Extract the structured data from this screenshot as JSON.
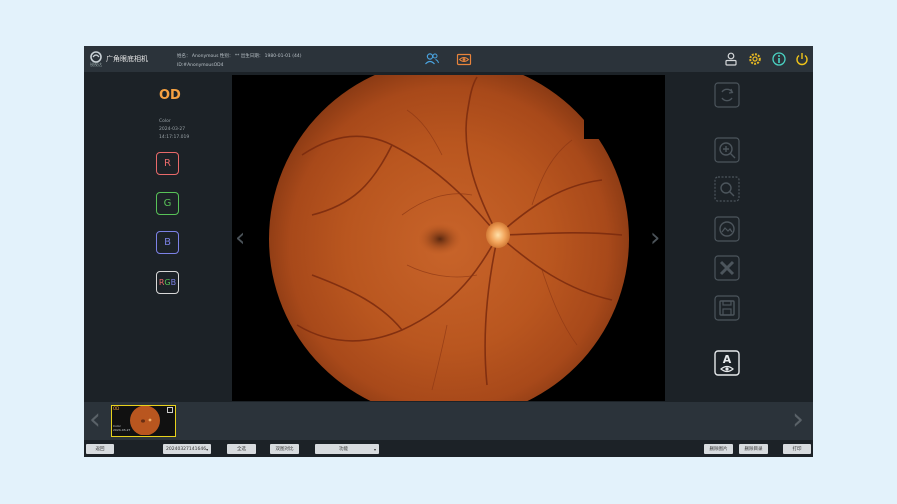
{
  "header": {
    "logo_text": "锐视达",
    "app_title": "广角眼底相机",
    "patient_line1": "姓名： Anonymous   性别： **   出生日期： 1980-01-01 (44)",
    "patient_line2": "ID:#AnonymousOD4"
  },
  "left_panel": {
    "eye": "OD",
    "mode": "Color",
    "date": "2024-03-27",
    "time": "14:17:17.019",
    "channels": [
      {
        "label": "R",
        "color": "#e86a6a"
      },
      {
        "label": "G",
        "color": "#58c258"
      },
      {
        "label": "B",
        "color": "#7c82e6"
      },
      {
        "label": "RGB",
        "color": "#d8d8d8"
      }
    ]
  },
  "filmstrip": {
    "thumb_eye": "OD",
    "thumb_text": "Color\n2024-03-27"
  },
  "bottom": {
    "back": "返回",
    "date_select": "20240327141646",
    "select_all": "全选",
    "compare": "双图对比",
    "function_select": "功能",
    "delete_image": "删除图片",
    "delete_folder": "删除目录",
    "print": "打印"
  },
  "colors": {
    "accent_orange": "#f5a142",
    "selection_yellow": "#e8d21c",
    "app_bg": "#1c2227",
    "header_bg": "#2b333a"
  }
}
